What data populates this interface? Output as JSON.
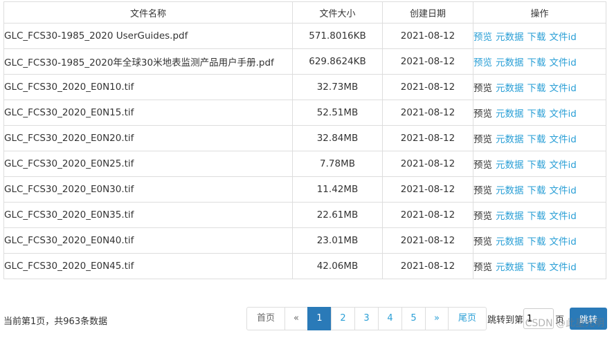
{
  "table": {
    "headers": [
      "文件名称",
      "文件大小",
      "创建日期",
      "操作"
    ],
    "actions": {
      "preview": "预览",
      "metadata": "元数据",
      "download": "下载",
      "file_id": "文件id"
    },
    "rows": [
      {
        "name": "GLC_FCS30-1985_2020 UserGuides.pdf",
        "size": "571.8016KB",
        "date": "2021-08-12",
        "preview_link": true
      },
      {
        "name": "GLC_FCS30-1985_2020年全球30米地表监测产品用户手册.pdf",
        "size": "629.8624KB",
        "date": "2021-08-12",
        "preview_link": true
      },
      {
        "name": "GLC_FCS30_2020_E0N10.tif",
        "size": "32.73MB",
        "date": "2021-08-12",
        "preview_link": false
      },
      {
        "name": "GLC_FCS30_2020_E0N15.tif",
        "size": "52.51MB",
        "date": "2021-08-12",
        "preview_link": false
      },
      {
        "name": "GLC_FCS30_2020_E0N20.tif",
        "size": "32.84MB",
        "date": "2021-08-12",
        "preview_link": false
      },
      {
        "name": "GLC_FCS30_2020_E0N25.tif",
        "size": "7.78MB",
        "date": "2021-08-12",
        "preview_link": false
      },
      {
        "name": "GLC_FCS30_2020_E0N30.tif",
        "size": "11.42MB",
        "date": "2021-08-12",
        "preview_link": false
      },
      {
        "name": "GLC_FCS30_2020_E0N35.tif",
        "size": "22.61MB",
        "date": "2021-08-12",
        "preview_link": false
      },
      {
        "name": "GLC_FCS30_2020_E0N40.tif",
        "size": "23.01MB",
        "date": "2021-08-12",
        "preview_link": false
      },
      {
        "name": "GLC_FCS30_2020_E0N45.tif",
        "size": "42.06MB",
        "date": "2021-08-12",
        "preview_link": false
      }
    ]
  },
  "footer": {
    "status": "当前第1页，共963条数据",
    "pagination": {
      "first": "首页",
      "prev": "«",
      "pages": [
        "1",
        "2",
        "3",
        "4",
        "5"
      ],
      "active_page": "1",
      "next": "»",
      "last": "尾页"
    },
    "jump": {
      "label_before": "跳转到第",
      "input_value": "1",
      "label_after": "页",
      "button": "跳转"
    }
  },
  "watermark": "CSDN @此星光明",
  "colors": {
    "link": "#2a9fd6",
    "primary": "#2a7ab8",
    "border": "#dddddd",
    "text": "#333333"
  }
}
